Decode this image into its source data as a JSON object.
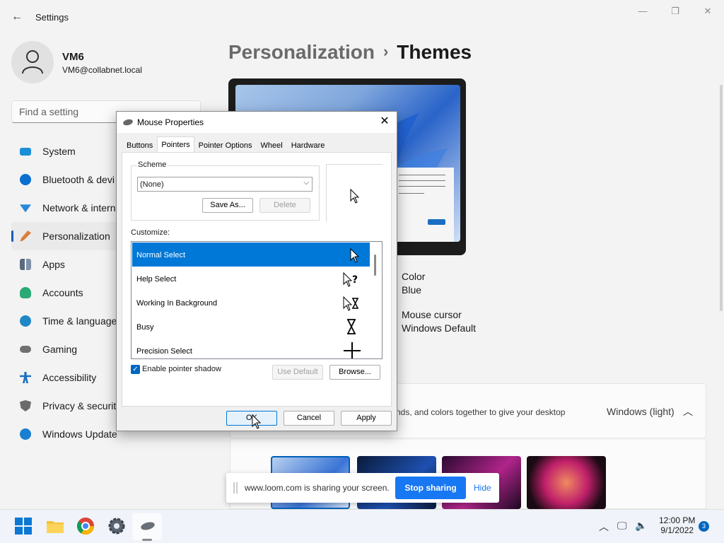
{
  "window": {
    "title": "Settings",
    "minimize": "—",
    "maximize": "❐",
    "close": "✕"
  },
  "profile": {
    "name": "VM6",
    "email": "VM6@collabnet.local"
  },
  "search": {
    "placeholder": "Find a setting"
  },
  "sidebar": {
    "items": [
      {
        "label": "System",
        "icon": "system-icon",
        "color": "#1a8fd8"
      },
      {
        "label": "Bluetooth & devi",
        "icon": "bluetooth-icon",
        "color": "#0a6fd1"
      },
      {
        "label": "Network & intern",
        "icon": "network-icon",
        "color": "#2b88d8"
      },
      {
        "label": "Personalization",
        "icon": "paintbrush-icon",
        "color": "#e3853b"
      },
      {
        "label": "Apps",
        "icon": "apps-icon",
        "color": "#5a6a80"
      },
      {
        "label": "Accounts",
        "icon": "accounts-icon",
        "color": "#2aa876"
      },
      {
        "label": "Time & language",
        "icon": "time-language-icon",
        "color": "#1e88c6"
      },
      {
        "label": "Gaming",
        "icon": "gaming-icon",
        "color": "#707070"
      },
      {
        "label": "Accessibility",
        "icon": "accessibility-icon",
        "color": "#1a6fc0"
      },
      {
        "label": "Privacy & security",
        "icon": "shield-icon",
        "color": "#6a6a6a"
      },
      {
        "label": "Windows Update",
        "icon": "windows-update-icon",
        "color": "#1a7fd0"
      }
    ]
  },
  "main": {
    "breadcrumb_parent": "Personalization",
    "breadcrumb_sep": "›",
    "breadcrumb_current": "Themes",
    "color_label": "Color",
    "color_value": "Blue",
    "cursor_label": "Mouse cursor",
    "cursor_value": "Windows Default",
    "themes_desc": "nds, and colors together to give your desktop",
    "themes_current": "Windows (light)"
  },
  "dialog": {
    "title": "Mouse Properties",
    "tabs": [
      "Buttons",
      "Pointers",
      "Pointer Options",
      "Wheel",
      "Hardware"
    ],
    "active_tab": "Pointers",
    "scheme_label": "Scheme",
    "scheme_value": "(None)",
    "save_as": "Save As...",
    "delete": "Delete",
    "customize_label": "Customize:",
    "pointers": [
      {
        "label": "Normal Select",
        "glyph": "➤"
      },
      {
        "label": "Help Select",
        "glyph": "?"
      },
      {
        "label": "Working In Background",
        "glyph": "⧗"
      },
      {
        "label": "Busy",
        "glyph": "⧗"
      },
      {
        "label": "Precision Select",
        "glyph": "+"
      }
    ],
    "enable_shadow": "Enable pointer shadow",
    "use_default": "Use Default",
    "browse": "Browse...",
    "ok": "OK",
    "cancel": "Cancel",
    "apply": "Apply"
  },
  "loom": {
    "message": "www.loom.com is sharing your screen.",
    "stop": "Stop sharing",
    "hide": "Hide"
  },
  "taskbar": {
    "time": "12:00 PM",
    "date": "9/1/2022",
    "notifications": "3"
  },
  "colors": {
    "accent": "#005fb8",
    "selection": "#0078d7",
    "loom_blue": "#1877f2"
  }
}
